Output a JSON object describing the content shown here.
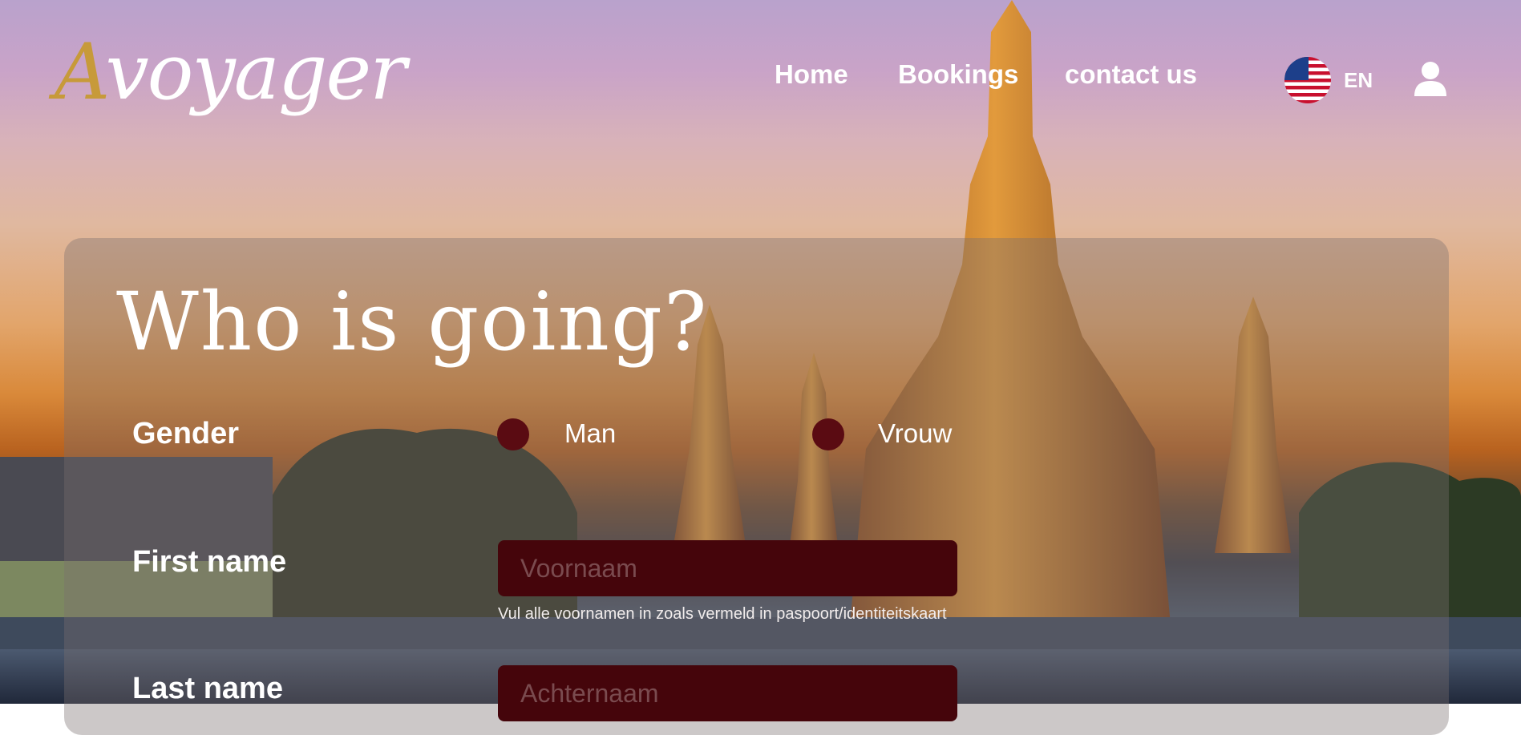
{
  "header": {
    "logo_first": "A",
    "logo_rest": "voyager",
    "nav": [
      "Home",
      "Bookings",
      "contact us"
    ],
    "language": "EN"
  },
  "form": {
    "title": "Who is going?",
    "gender_label": "Gender",
    "gender_options": [
      "Man",
      "Vrouw"
    ],
    "first_name_label": "First name",
    "first_name_placeholder": "Voornaam",
    "first_name_hint": "Vul alle voornamen in zoals vermeld in paspoort/identiteitskaart",
    "last_name_label": "Last name",
    "last_name_placeholder": "Achternaam"
  },
  "colors": {
    "accent_gold": "#c79a3a",
    "field_background": "#45050b",
    "radio_fill": "#5a0b12"
  },
  "icons": [
    "us-flag-icon",
    "user-icon"
  ]
}
